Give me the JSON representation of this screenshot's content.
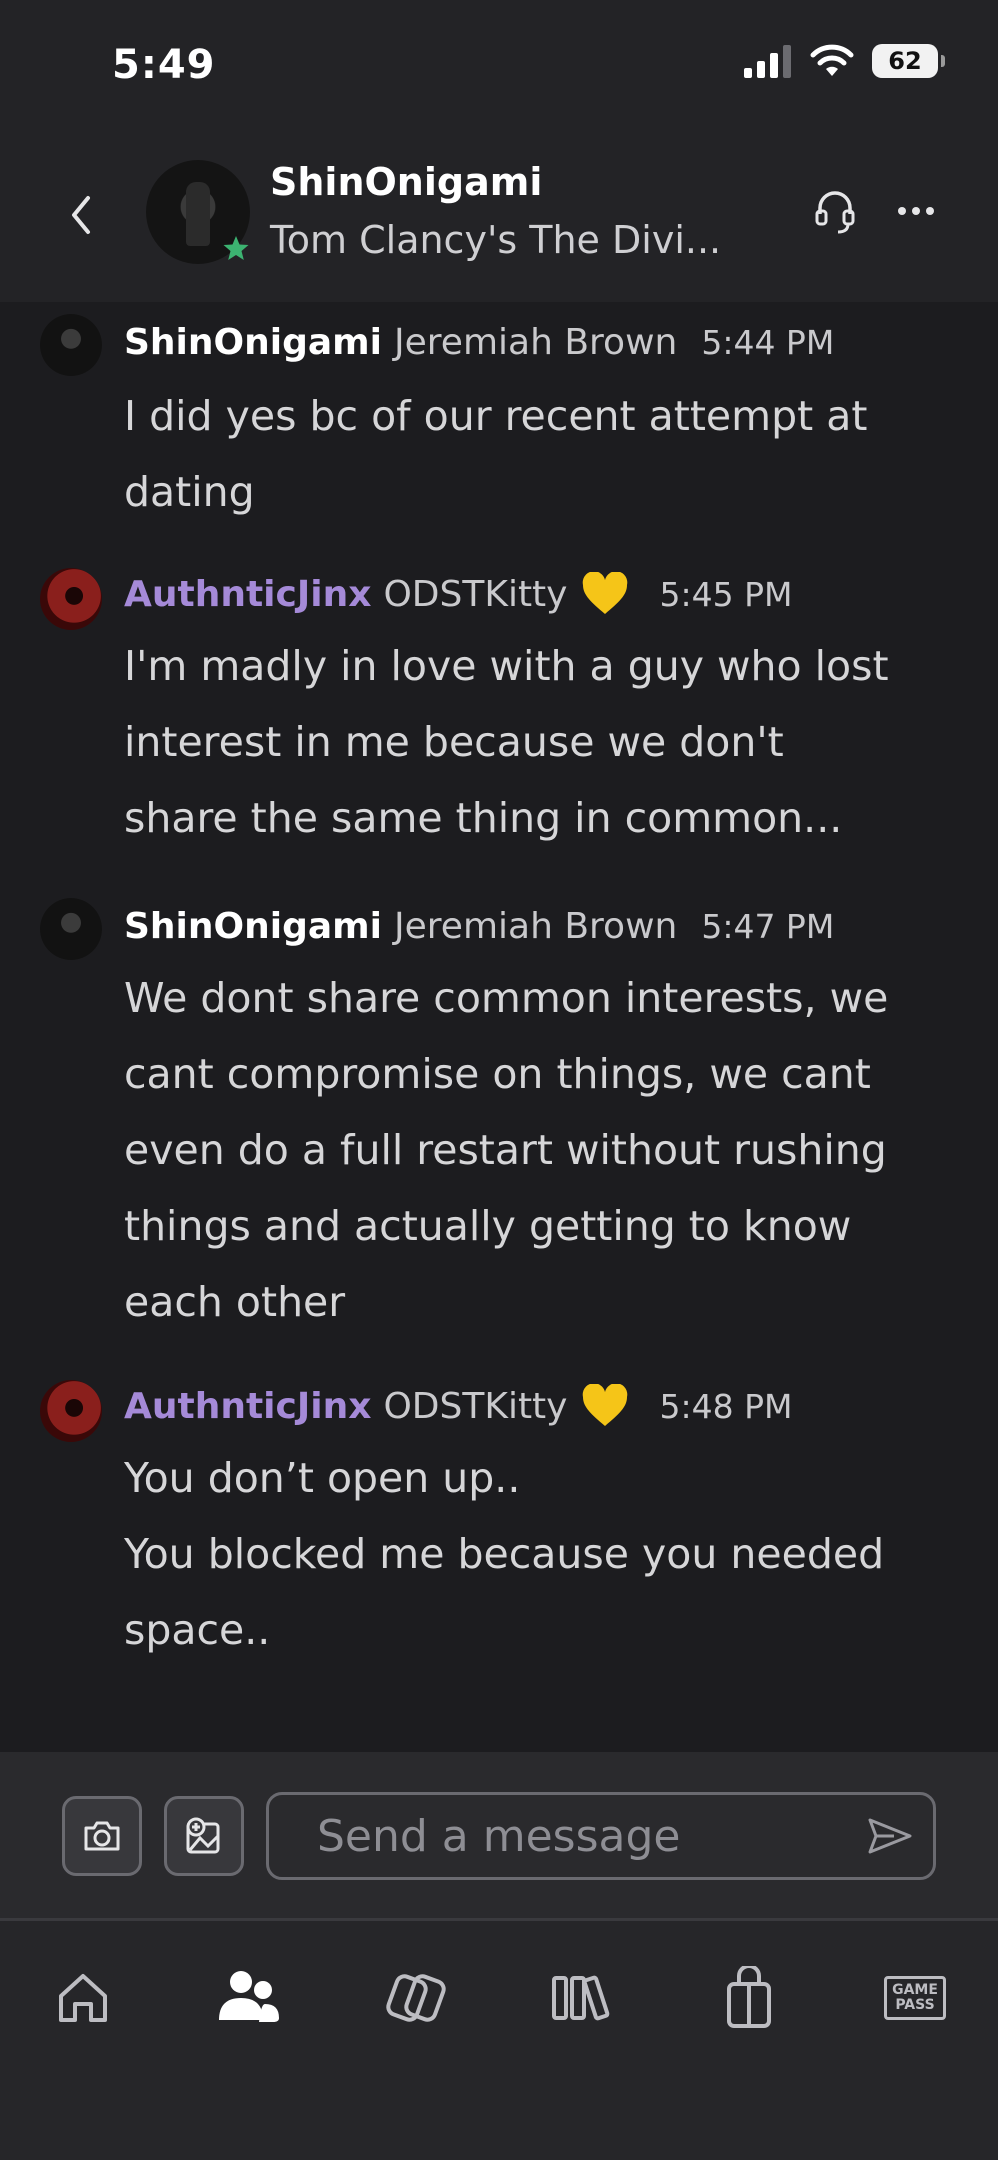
{
  "status_bar": {
    "time": "5:49",
    "battery": "62"
  },
  "header": {
    "name": "ShinOnigami",
    "subtitle": "Tom Clancy's The Divi..."
  },
  "messages": [
    {
      "username": "ShinOnigami",
      "realname": "Jeremiah Brown",
      "time": "5:44 PM",
      "lines": [
        "I did yes bc of our recent attempt at",
        "dating"
      ]
    },
    {
      "username": "AuthnticJinx",
      "realname": "ODSTKitty",
      "emoji": "yellow-heart",
      "time": "5:45 PM",
      "lines": [
        "I'm madly in love with a guy who lost",
        "interest in me because we don't",
        "share the same thing in common..."
      ]
    },
    {
      "username": "ShinOnigami",
      "realname": "Jeremiah Brown",
      "time": "5:47 PM",
      "lines": [
        "We dont share common interests, we",
        "cant compromise on things, we cant",
        "even do a full restart without rushing",
        "things and actually getting to know",
        "each other"
      ]
    },
    {
      "username": "AuthnticJinx",
      "realname": "ODSTKitty",
      "emoji": "yellow-heart",
      "time": "5:48 PM",
      "lines": [
        "You don’t open up..",
        "You blocked me because you needed",
        "space.."
      ]
    }
  ],
  "composer": {
    "placeholder": "Send a message"
  },
  "bottom_nav": {
    "items": [
      "home-icon",
      "friends-icon",
      "xbox-cloud-icon",
      "library-icon",
      "store-icon",
      "game-pass-icon"
    ],
    "game_pass_line1": "GAME",
    "game_pass_line2": "PASS"
  },
  "colors": {
    "background": "#1c1c1f",
    "header": "#232326",
    "accent_purple": "#a58ad8",
    "presence_green": "#3cb371",
    "heart_yellow": "#f5c518"
  }
}
